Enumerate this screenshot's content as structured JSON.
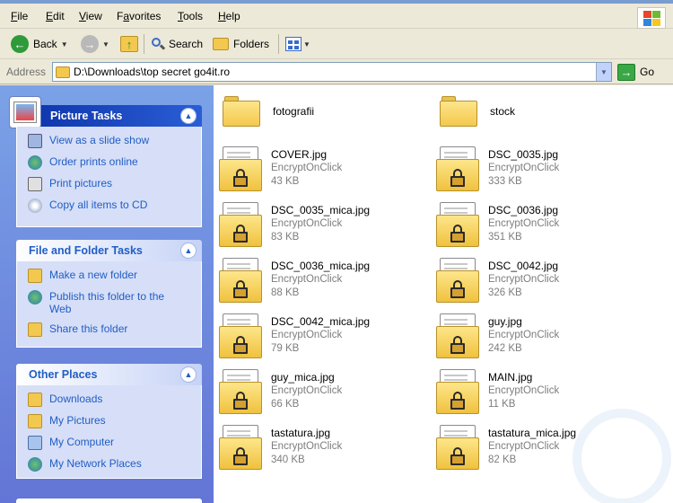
{
  "menu": {
    "items": [
      {
        "accel": "F",
        "rest": "ile"
      },
      {
        "accel": "E",
        "rest": "dit"
      },
      {
        "accel": "V",
        "rest": "iew"
      },
      {
        "accel": "a",
        "pre": "F",
        "rest": "vorites"
      },
      {
        "accel": "T",
        "rest": "ools"
      },
      {
        "accel": "H",
        "rest": "elp"
      }
    ]
  },
  "toolbar": {
    "back_label": "Back",
    "search_label": "Search",
    "folders_label": "Folders"
  },
  "address": {
    "label": "Address",
    "value": "D:\\Downloads\\top secret go4it.ro",
    "go_label": "Go"
  },
  "taskpane": {
    "picture_tasks": {
      "title": "Picture Tasks",
      "items": [
        "View as a slide show",
        "Order prints online",
        "Print pictures",
        "Copy all items to CD"
      ]
    },
    "file_folder_tasks": {
      "title": "File and Folder Tasks",
      "items": [
        "Make a new folder",
        "Publish this folder to the Web",
        "Share this folder"
      ]
    },
    "other_places": {
      "title": "Other Places",
      "items": [
        "Downloads",
        "My Pictures",
        "My Computer",
        "My Network Places"
      ]
    }
  },
  "folders": [
    {
      "name": "fotografii"
    },
    {
      "name": "stock"
    }
  ],
  "files": [
    {
      "name": "COVER.jpg",
      "type": "EncryptOnClick",
      "size": "43 KB"
    },
    {
      "name": "DSC_0035.jpg",
      "type": "EncryptOnClick",
      "size": "333 KB"
    },
    {
      "name": "DSC_0035_mica.jpg",
      "type": "EncryptOnClick",
      "size": "83 KB"
    },
    {
      "name": "DSC_0036.jpg",
      "type": "EncryptOnClick",
      "size": "351 KB"
    },
    {
      "name": "DSC_0036_mica.jpg",
      "type": "EncryptOnClick",
      "size": "88 KB"
    },
    {
      "name": "DSC_0042.jpg",
      "type": "EncryptOnClick",
      "size": "326 KB"
    },
    {
      "name": "DSC_0042_mica.jpg",
      "type": "EncryptOnClick",
      "size": "79 KB"
    },
    {
      "name": "guy.jpg",
      "type": "EncryptOnClick",
      "size": "242 KB"
    },
    {
      "name": "guy_mica.jpg",
      "type": "EncryptOnClick",
      "size": "66 KB"
    },
    {
      "name": "MAIN.jpg",
      "type": "EncryptOnClick",
      "size": "11 KB"
    },
    {
      "name": "tastatura.jpg",
      "type": "EncryptOnClick",
      "size": "340 KB"
    },
    {
      "name": "tastatura_mica.jpg",
      "type": "EncryptOnClick",
      "size": "82 KB"
    }
  ],
  "colors": {
    "taskpane_gradient_top": "#7ba2e7",
    "taskpane_gradient_bottom": "#6375d6",
    "link_blue": "#215dc6",
    "folder_yellow": "#f3c84e"
  }
}
